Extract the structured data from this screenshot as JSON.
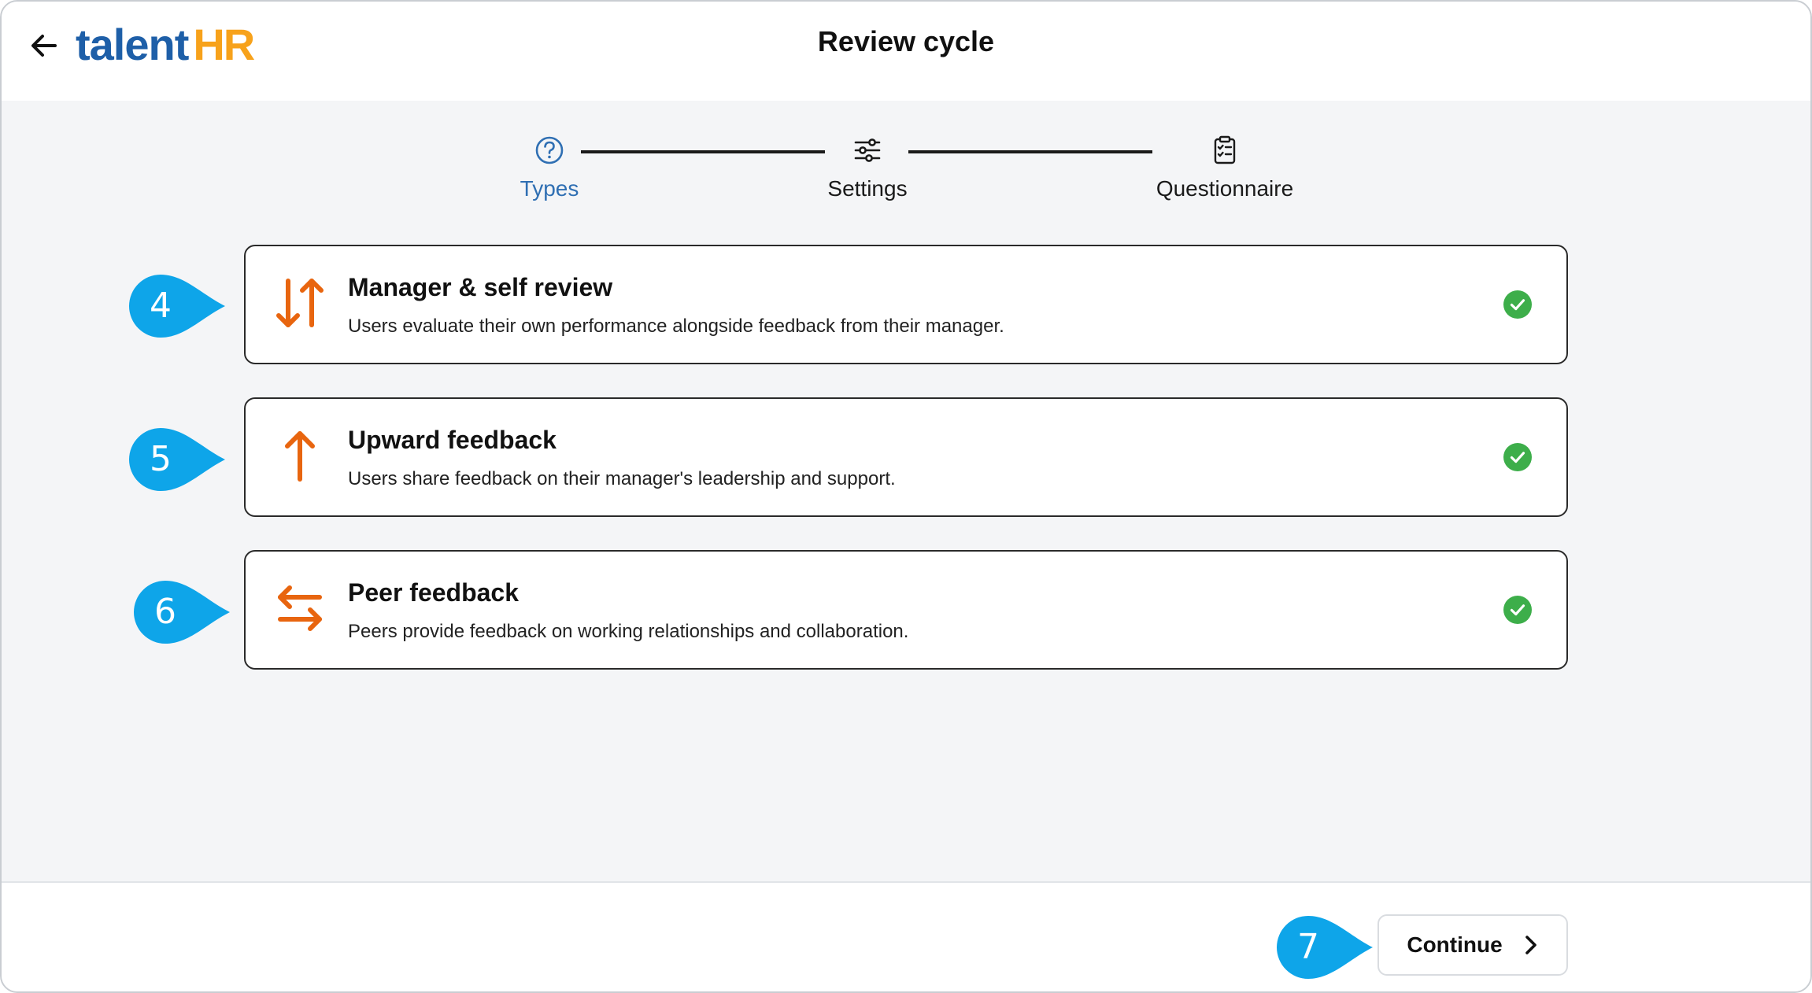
{
  "header": {
    "back_icon": "arrow-left-icon",
    "logo_text": "talent",
    "logo_accent": "HR",
    "title": "Review cycle"
  },
  "stepper": {
    "steps": [
      {
        "label": "Types",
        "icon": "question-circle-icon",
        "active": true
      },
      {
        "label": "Settings",
        "icon": "sliders-icon",
        "active": false
      },
      {
        "label": "Questionnaire",
        "icon": "clipboard-checklist-icon",
        "active": false
      }
    ]
  },
  "review_types": [
    {
      "callout": "4",
      "title": "Manager & self review",
      "description": "Users evaluate their own performance alongside feedback from their manager.",
      "icon": "arrows-up-down-icon",
      "selected": true
    },
    {
      "callout": "5",
      "title": "Upward feedback",
      "description": "Users share feedback on their manager's leadership and support.",
      "icon": "arrow-up-icon",
      "selected": true
    },
    {
      "callout": "6",
      "title": "Peer feedback",
      "description": "Peers provide feedback on working relationships and collaboration.",
      "icon": "arrows-left-right-icon",
      "selected": true
    }
  ],
  "footer": {
    "callout": "7",
    "continue_label": "Continue",
    "continue_icon": "chevron-right-icon"
  },
  "colors": {
    "brand_blue": "#1e5fa8",
    "brand_orange": "#f7a21b",
    "icon_orange": "#e8650f",
    "active_step": "#2f6fb3",
    "check_green": "#3dae4a",
    "callout_blue": "#0ea5e9",
    "background": "#f4f5f7"
  }
}
